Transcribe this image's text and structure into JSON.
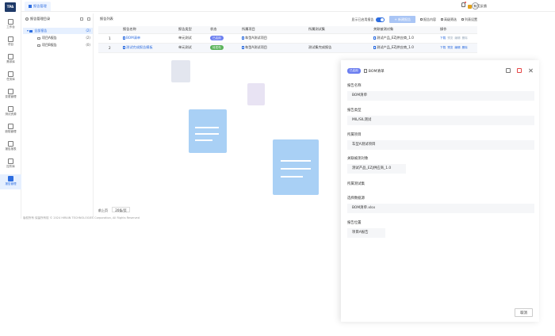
{
  "app": {
    "logo_text": "TPA"
  },
  "nav": [
    {
      "label": "工作台"
    },
    {
      "label": "项目"
    },
    {
      "label": "需求库"
    },
    {
      "label": "任务库"
    },
    {
      "label": "变更管理"
    },
    {
      "label": "测试资源"
    },
    {
      "label": "缺陷管理"
    },
    {
      "label": "报告报表"
    },
    {
      "label": "控件库"
    },
    {
      "label": "报告管理"
    }
  ],
  "topbar": {
    "tab_label": "报告管理",
    "gift_label": "有奖反馈"
  },
  "tree": {
    "title": "报告管理目录",
    "nodes": [
      {
        "label": "全部报告",
        "count": "(2)"
      },
      {
        "label": "项目A报告",
        "count": "(2)"
      },
      {
        "label": "项目B报告",
        "count": "(0)"
      }
    ]
  },
  "main": {
    "title": "报告列表",
    "show_enabled_label": "显示已启用报告",
    "new_button": "+ 新建报告",
    "toolbar_links": [
      "报告内容",
      "高级筛选",
      "列表设置"
    ],
    "columns": [
      "",
      "报告名称",
      "报告类型",
      "状态",
      "所属项目",
      "所属测试集",
      "关联被测对象",
      "操作"
    ],
    "rows": [
      {
        "index": "1",
        "name": "BOM清单",
        "type": "单元测试",
        "status": "已启用",
        "project": "车型A测试项目",
        "testset": "",
        "object": "测试产品_EZJ供应商_1.0",
        "ops": [
          "下载",
          "预览",
          "编辑",
          "删除"
        ]
      },
      {
        "index": "2",
        "name": "测试完成报告模板",
        "type": "单元测试",
        "status": "待发布",
        "project": "车型A测试项目",
        "testset": "测试集完成报告",
        "object": "测试产品_EZJ供应商_1.0",
        "ops": [
          "下载",
          "预览",
          "编辑",
          "删除"
        ]
      }
    ],
    "pager": {
      "prev": "前上页",
      "size": "20条/页"
    }
  },
  "copyright": "版权所有 保留所有权 © 2024 HIRAIN TECHNOLOGIES Corporation, All Rights Reserved",
  "drawer": {
    "status": "已启用",
    "title": "BOM清单",
    "fields": [
      {
        "label": "报告名称",
        "value": "BOM清单"
      },
      {
        "label": "报告类型",
        "value": "MIL/SIL测试"
      },
      {
        "label": "所属项目",
        "value": "车型A测试项目"
      },
      {
        "label": "关联被测对象",
        "value": "测试产品_EZJ供应商_1.0"
      },
      {
        "label": "所属测试集",
        "value": ""
      },
      {
        "label": "选择数据源",
        "value": "BOM清单.xlsx"
      },
      {
        "label": "报告位置",
        "value": "项目A报告"
      }
    ],
    "cancel": "取消"
  },
  "colors": {
    "accent": "#2d6de0",
    "enabled": "#6c7ff0",
    "pending": "#5ab35a",
    "doc_light": "#a9d0f5",
    "doc_faint": "#e3e6ef"
  }
}
